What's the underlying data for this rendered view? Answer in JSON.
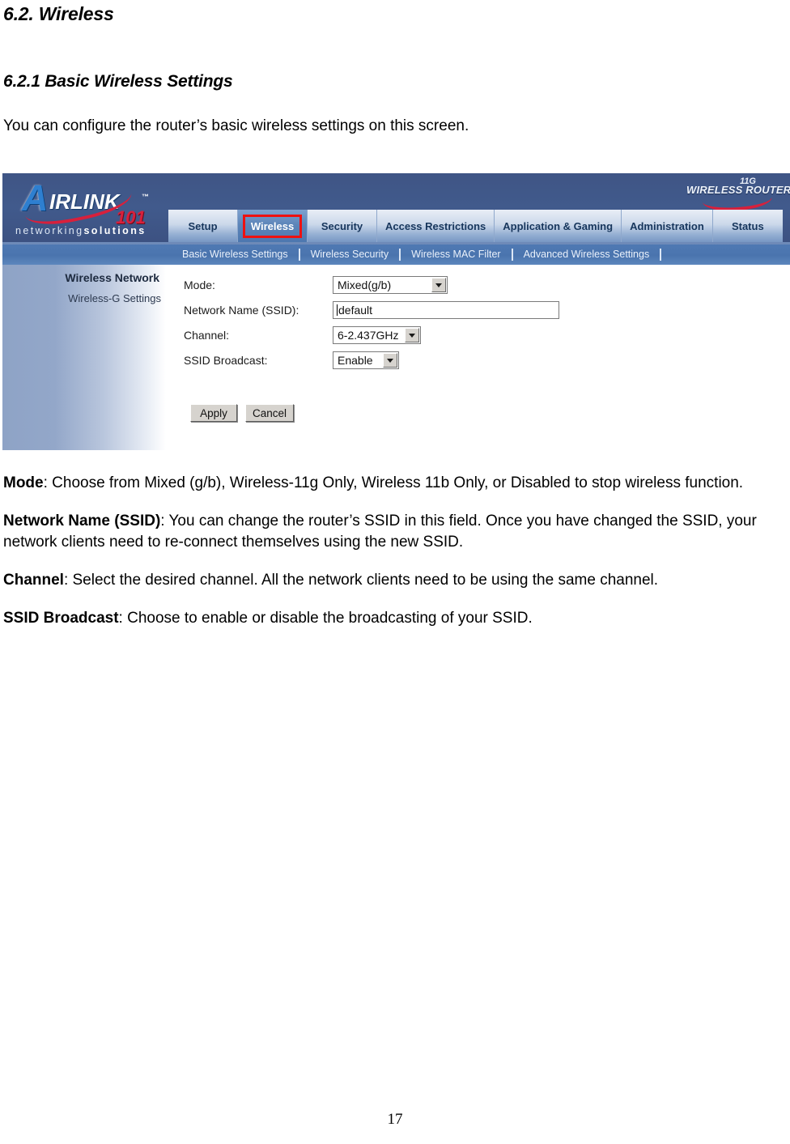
{
  "document": {
    "section_heading": "6.2. Wireless",
    "subsection_heading": "6.2.1 Basic Wireless Settings",
    "intro": "You can configure the router’s basic wireless settings on this screen.",
    "page_number": "17",
    "descriptions": [
      {
        "term": "Mode",
        "text": ": Choose from Mixed (g/b), Wireless-11g Only, Wireless 11b Only, or Disabled to stop wireless function."
      },
      {
        "term": "Network Name (SSID)",
        "text": ": You can change the router’s SSID in this field. Once you have changed the SSID, your network clients need to re-connect themselves using the new SSID."
      },
      {
        "term": "Channel",
        "text": ": Select the desired channel. All the network clients need to be using the same channel."
      },
      {
        "term": "SSID Broadcast",
        "text": ": Choose to enable or disable the broadcasting of your SSID."
      }
    ]
  },
  "router_ui": {
    "logo": {
      "letter_a": "A",
      "word_rest": "IRLINK",
      "trademark": "™",
      "model": "101",
      "tagline_light": "networking",
      "tagline_bold": "solutions"
    },
    "corner_mark": {
      "standard": "11G",
      "product": "WIRELESS ROUTER"
    },
    "tabs": [
      {
        "label": "Setup",
        "active": false
      },
      {
        "label": "Wireless",
        "active": true
      },
      {
        "label": "Security",
        "active": false
      },
      {
        "label": "Access Restrictions",
        "active": false
      },
      {
        "label": "Application & Gaming",
        "active": false
      },
      {
        "label": "Administration",
        "active": false
      },
      {
        "label": "Status",
        "active": false
      }
    ],
    "subtabs": [
      "Basic Wireless Settings",
      "Wireless Security",
      "Wireless MAC Filter",
      "Advanced Wireless Settings"
    ],
    "panel": {
      "title": "Wireless Network",
      "subtitle": "Wireless-G Settings"
    },
    "form": {
      "mode_label": "Mode:",
      "mode_value": "Mixed(g/b)",
      "ssid_label": "Network Name (SSID):",
      "ssid_value": "default",
      "channel_label": "Channel:",
      "channel_value": "6-2.437GHz",
      "broadcast_label": "SSID Broadcast:",
      "broadcast_value": "Enable"
    },
    "buttons": {
      "apply": "Apply",
      "cancel": "Cancel"
    },
    "colors": {
      "header_blue": "#415a8c",
      "subnav_blue": "#4a74ae",
      "active_tab_blue": "#5b84b8",
      "highlight_red": "#ee1111",
      "logo_red": "#d8203c",
      "logo_blue": "#2e7fd0"
    }
  }
}
